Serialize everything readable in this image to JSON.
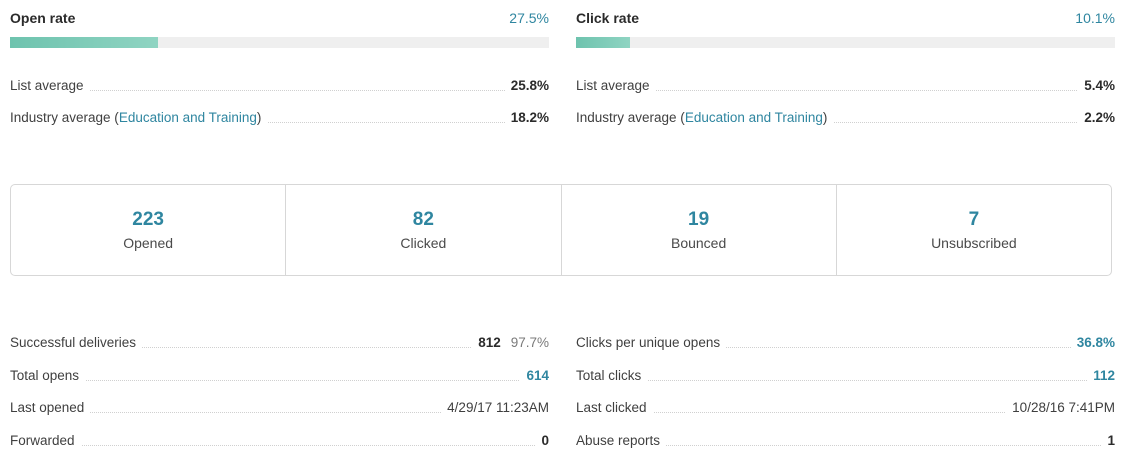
{
  "open_rate": {
    "title": "Open rate",
    "value": "27.5%",
    "fraction": 0.275,
    "rows": [
      {
        "label": "List average",
        "value": "25.8%"
      },
      {
        "label_prefix": "Industry average (",
        "label_link": "Education and Training",
        "label_suffix": ")",
        "value": "18.2%"
      }
    ]
  },
  "click_rate": {
    "title": "Click rate",
    "value": "10.1%",
    "fraction": 0.101,
    "rows": [
      {
        "label": "List average",
        "value": "5.4%"
      },
      {
        "label_prefix": "Industry average (",
        "label_link": "Education and Training",
        "label_suffix": ")",
        "value": "2.2%"
      }
    ]
  },
  "stats": [
    {
      "number": "223",
      "label": "Opened"
    },
    {
      "number": "82",
      "label": "Clicked"
    },
    {
      "number": "19",
      "label": "Bounced"
    },
    {
      "number": "7",
      "label": "Unsubscribed"
    }
  ],
  "details_left": [
    {
      "label": "Successful deliveries",
      "value": "812",
      "extra": "97.7%"
    },
    {
      "label": "Total opens",
      "value": "614",
      "link": true
    },
    {
      "label": "Last opened",
      "value": "4/29/17 11:23AM",
      "plain": true
    },
    {
      "label": "Forwarded",
      "value": "0"
    }
  ],
  "details_right": [
    {
      "label": "Clicks per unique opens",
      "value": "36.8%",
      "link": true
    },
    {
      "label": "Total clicks",
      "value": "112",
      "link": true
    },
    {
      "label": "Last clicked",
      "value": "10/28/16 7:41PM",
      "plain": true
    },
    {
      "label": "Abuse reports",
      "value": "1"
    }
  ],
  "colors": {
    "accent": "#2f86a0",
    "bar_fill": "#6ec3ae",
    "bar_track": "#efefef"
  }
}
